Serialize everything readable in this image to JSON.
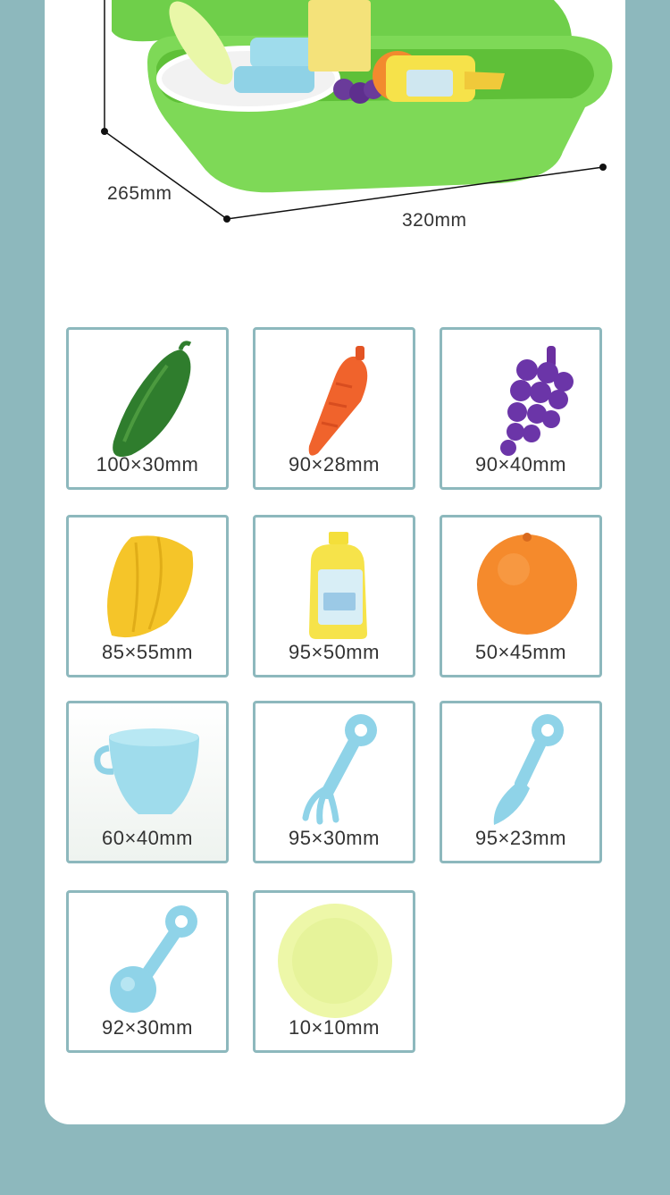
{
  "product": {
    "depth_label": "265mm",
    "width_label": "320mm"
  },
  "items": [
    {
      "name": "cucumber",
      "size": "100×30mm"
    },
    {
      "name": "carrot",
      "size": "90×28mm"
    },
    {
      "name": "grapes",
      "size": "90×40mm"
    },
    {
      "name": "starfruit",
      "size": "85×55mm"
    },
    {
      "name": "detergent-bottle",
      "size": "95×50mm"
    },
    {
      "name": "orange",
      "size": "50×45mm"
    },
    {
      "name": "cup",
      "size": "60×40mm"
    },
    {
      "name": "fork",
      "size": "95×30mm"
    },
    {
      "name": "knife",
      "size": "95×23mm"
    },
    {
      "name": "spoon",
      "size": "92×30mm"
    },
    {
      "name": "plate",
      "size": "10×10mm"
    }
  ],
  "colors": {
    "background": "#8db8bd",
    "card": "#ffffff",
    "tile_border": "#8db8bd",
    "sink_green": "#7ed957",
    "toy_blue": "#9fdcec"
  }
}
